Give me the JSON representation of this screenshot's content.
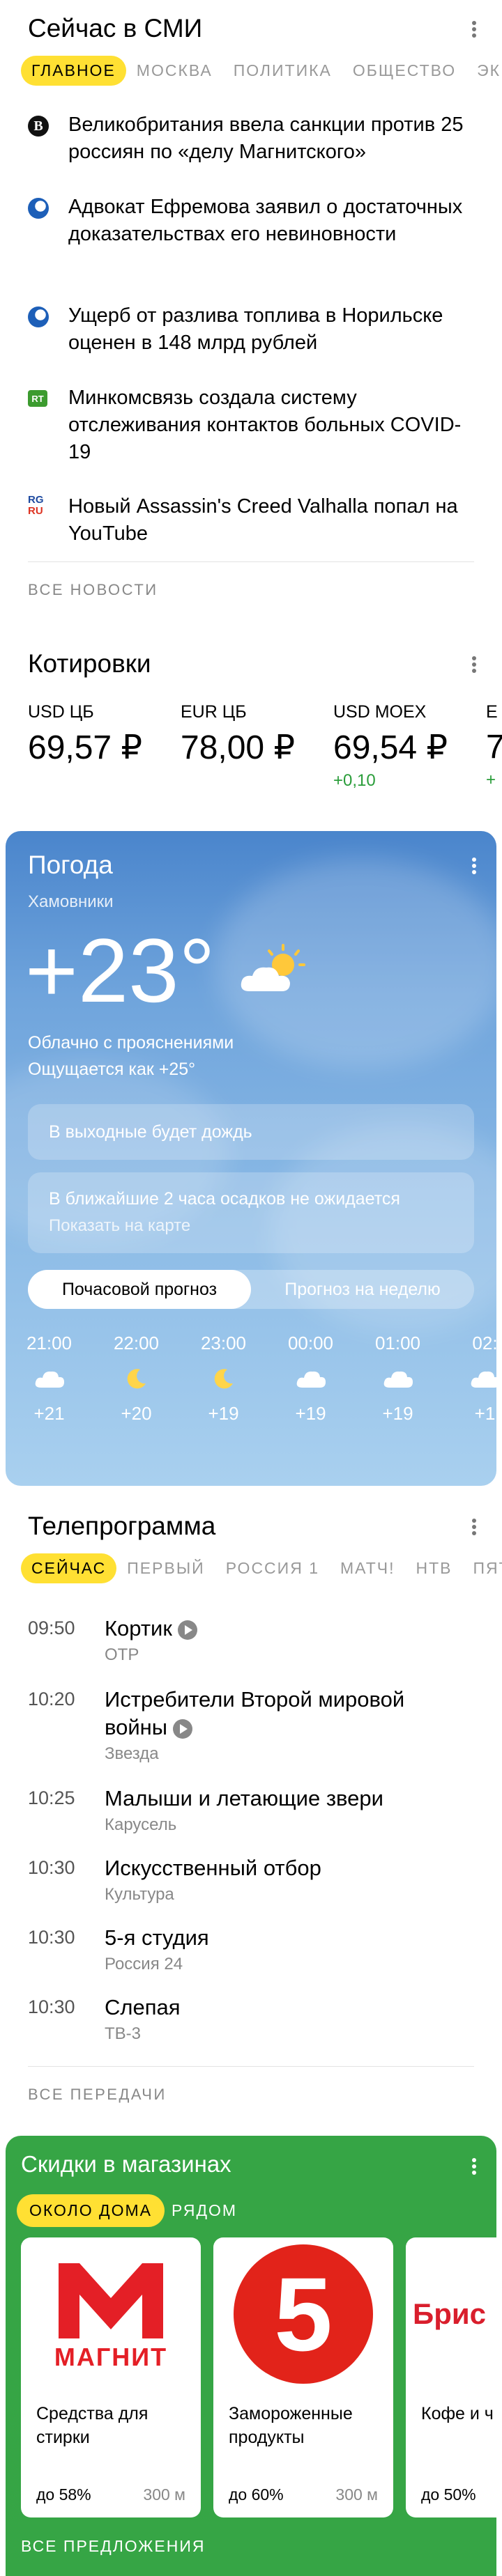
{
  "media": {
    "title": "Сейчас в СМИ",
    "tabs": [
      "ГЛАВНОЕ",
      "МОСКВА",
      "ПОЛИТИКА",
      "ОБЩЕСТВО",
      "ЭК"
    ],
    "news": [
      {
        "text": "Великобритания ввела санкции против 25 россиян по «делу Магнитского»",
        "src_icon": "bbc-icon"
      },
      {
        "text": "Адвокат Ефремова заявил о достаточных доказательствах его невиновности",
        "src_icon": "ria-icon"
      },
      {
        "text": "Ущерб от разлива топлива в Норильске оценен в 148 млрд рублей",
        "src_icon": "ria-icon"
      },
      {
        "text": "Минкомсвязь создала систему отслеживания контактов больных COVID-19",
        "src_icon": "rt-icon"
      },
      {
        "text": "Новый Assassin's Creed Valhalla попал на YouTube",
        "src_icon": "rg-icon"
      }
    ],
    "all": "ВСЕ НОВОСТИ"
  },
  "quotes": {
    "title": "Котировки",
    "items": [
      {
        "name": "USD ЦБ",
        "value": "69,57 ₽",
        "delta": ""
      },
      {
        "name": "EUR ЦБ",
        "value": "78,00 ₽",
        "delta": ""
      },
      {
        "name": "USD MOEX",
        "value": "69,54 ₽",
        "delta": "+0,10"
      },
      {
        "name": "E",
        "value": "7",
        "delta": "+"
      }
    ]
  },
  "weather": {
    "title": "Погода",
    "location": "Хамовники",
    "temp": "+23°",
    "desc": "Облачно с прояснениями",
    "feels": "Ощущается как +25°",
    "weekend": "В выходные будет дождь",
    "precip": "В ближайшие 2 часа осадков не ожидается",
    "map": "Показать на карте",
    "seg_hourly": "Почасовой прогноз",
    "seg_weekly": "Прогноз на неделю",
    "hours": [
      {
        "time": "21:00",
        "icon": "cloud",
        "temp": "+21"
      },
      {
        "time": "22:00",
        "icon": "moon",
        "temp": "+20"
      },
      {
        "time": "23:00",
        "icon": "moon",
        "temp": "+19"
      },
      {
        "time": "00:00",
        "icon": "cloud",
        "temp": "+19"
      },
      {
        "time": "01:00",
        "icon": "cloud",
        "temp": "+19"
      },
      {
        "time": "02:",
        "icon": "cloud",
        "temp": "+1"
      }
    ]
  },
  "tv": {
    "title": "Телепрограмма",
    "tabs": [
      "СЕЙЧАС",
      "ПЕРВЫЙ",
      "РОССИЯ 1",
      "МАТЧ!",
      "НТВ",
      "ПЯТ"
    ],
    "items": [
      {
        "time": "09:50",
        "name": "Кортик",
        "channel": "ОТР"
      },
      {
        "time": "10:20",
        "name": "Истребители Второй мировой войны",
        "channel": "Звезда"
      },
      {
        "time": "10:25",
        "name": "Малыши и летающие звери",
        "channel": "Карусель"
      },
      {
        "time": "10:30",
        "name": "Искусственный отбор",
        "channel": "Культура"
      },
      {
        "time": "10:30",
        "name": "5-я студия",
        "channel": "Россия 24"
      },
      {
        "time": "10:30",
        "name": "Слепая",
        "channel": "ТВ-3"
      }
    ],
    "all": "ВСЕ ПЕРЕДАЧИ"
  },
  "shops": {
    "title": "Скидки в магазинах",
    "tab_near": "ОКОЛО ДОМА",
    "tab_close": "РЯДОМ",
    "magnit_logo": "МАГНИТ",
    "five_logo": "5",
    "bristol_logo": "Брис",
    "cards": [
      {
        "title": "Средства для стирки",
        "discount": "до 58%",
        "dist": "300 м"
      },
      {
        "title": "Замороженные продукты",
        "discount": "до 60%",
        "dist": "300 м"
      },
      {
        "title": "Кофе и ч",
        "discount": "до 50%",
        "dist": ""
      }
    ],
    "all": "ВСЕ ПРЕДЛОЖЕНИЯ"
  }
}
